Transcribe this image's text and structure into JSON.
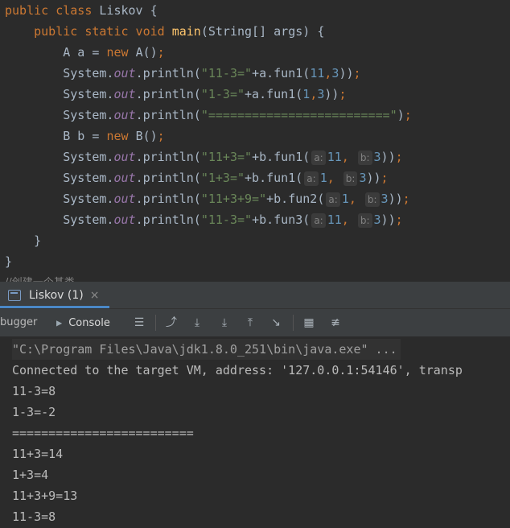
{
  "editor": {
    "lines": [
      {
        "t": "public class Liskov {"
      },
      {
        "t": "    public static void main(String[] args) {"
      },
      {
        "t": "        A a = new A();"
      },
      {
        "t": "        System.out.println(\"11-3=\"+a.fun1(11,3));"
      },
      {
        "t": "        System.out.println(\"1-3=\"+a.fun1(1,3));"
      },
      {
        "t": "        System.out.println(\"=========================\");"
      },
      {
        "t": "        B b = new B();"
      },
      {
        "t": "        System.out.println(\"11+3=\"+b.fun1( a: 11, b: 3));"
      },
      {
        "t": "        System.out.println(\"1+3=\"+b.fun1( a: 1, b: 3));"
      },
      {
        "t": "        System.out.println(\"11+3+9=\"+b.fun2( a: 1, b: 3));"
      },
      {
        "t": "        System.out.println(\"11-3=\"+b.fun3( a: 11, b: 3));"
      },
      {
        "t": "    }"
      },
      {
        "t": "}"
      }
    ],
    "faded_comment": "//创建一个基类"
  },
  "run_panel": {
    "tab_title": "Liskov (1)",
    "close_glyph": "×",
    "debugger_label": "bugger",
    "console_label": "Console"
  },
  "console": {
    "command_line": "\"C:\\Program Files\\Java\\jdk1.8.0_251\\bin\\java.exe\" ...",
    "connected_line": "Connected to the target VM, address: '127.0.0.1:54146', transp",
    "output": [
      "11-3=8",
      "1-3=-2",
      "=========================",
      "11+3=14",
      "1+3=4",
      "11+3+9=13",
      "11-3=8"
    ]
  },
  "colors": {
    "keyword": "#cc7832",
    "method": "#ffc66d",
    "string": "#6a8759",
    "number": "#6897bb",
    "static_field": "#9876aa",
    "accent": "#4a88c7"
  }
}
